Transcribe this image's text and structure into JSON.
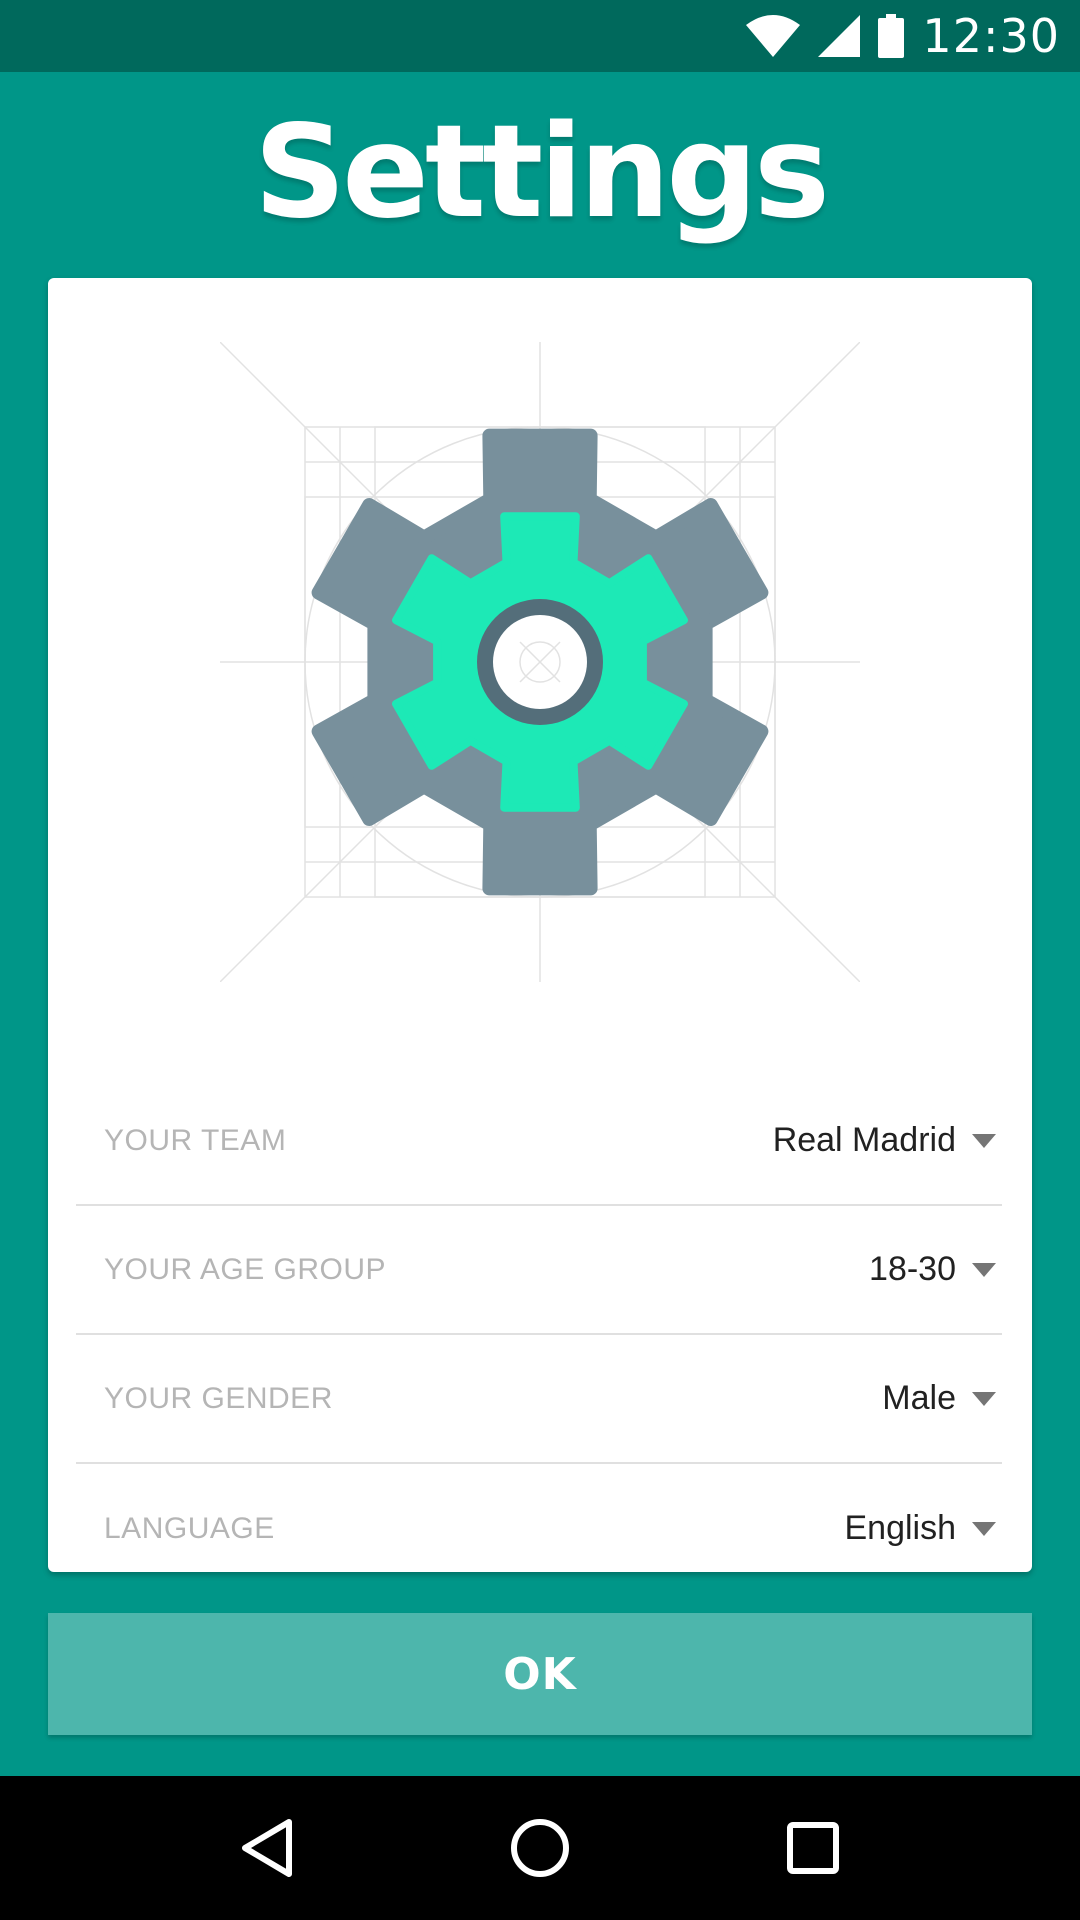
{
  "status_bar": {
    "time": "12:30",
    "icons": [
      "wifi-icon",
      "cell-signal-icon",
      "battery-icon"
    ]
  },
  "header": {
    "title": "Settings"
  },
  "illustration": {
    "icon": "gear-icon",
    "colors": {
      "outer_gear": "#78909c",
      "inner_gear": "#1de9b6",
      "hub": "#546e7a"
    }
  },
  "settings": [
    {
      "label": "YOUR TEAM",
      "value": "Real Madrid"
    },
    {
      "label": "YOUR AGE GROUP",
      "value": "18-30"
    },
    {
      "label": "YOUR GENDER",
      "value": "Male"
    },
    {
      "label": "LANGUAGE",
      "value": "English"
    }
  ],
  "ok_button": {
    "label": "OK"
  },
  "nav_bar": {
    "icons": [
      "back-icon",
      "home-icon",
      "recents-icon"
    ]
  },
  "colors": {
    "background": "#009688",
    "status_bar": "#00695c",
    "button": "#4db6ac"
  }
}
